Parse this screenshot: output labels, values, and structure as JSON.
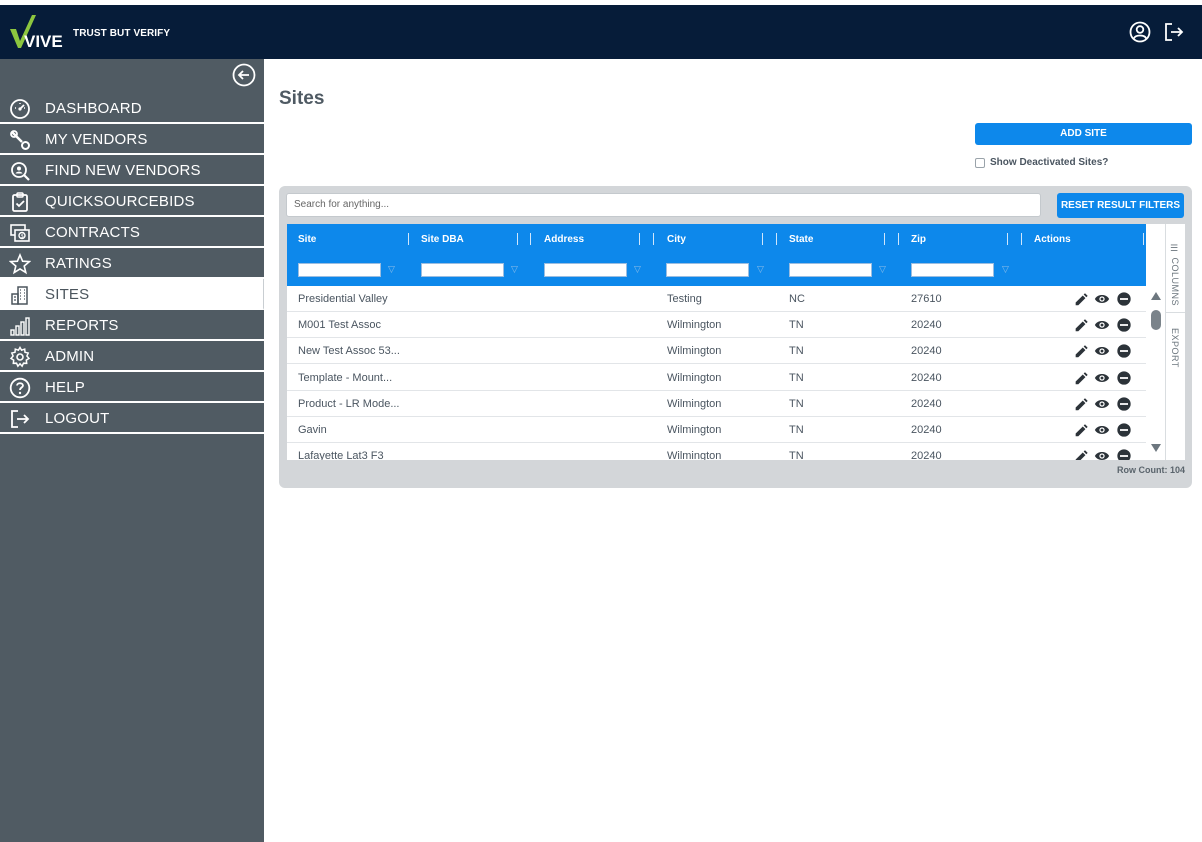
{
  "header": {
    "logo_text": "VIVE",
    "tagline": "TRUST BUT VERIFY",
    "brand_green": "#8cc63f",
    "navy": "#061c39",
    "icons": [
      "user-circle-icon",
      "logout-icon"
    ]
  },
  "sidebar": {
    "items": [
      {
        "label": "DASHBOARD",
        "icon": "speedometer-icon"
      },
      {
        "label": "MY VENDORS",
        "icon": "wrench-icon"
      },
      {
        "label": "FIND NEW VENDORS",
        "icon": "search-person-icon"
      },
      {
        "label": "QUICKSOURCEBIDS",
        "icon": "clipboard-check-icon"
      },
      {
        "label": "CONTRACTS",
        "icon": "money-icon"
      },
      {
        "label": "RATINGS",
        "icon": "star-icon"
      },
      {
        "label": "SITES",
        "icon": "building-icon",
        "active": true
      },
      {
        "label": "REPORTS",
        "icon": "bar-chart-icon"
      },
      {
        "label": "ADMIN",
        "icon": "gear-icon"
      },
      {
        "label": "HELP",
        "icon": "help-icon"
      },
      {
        "label": "LOGOUT",
        "icon": "logout-icon"
      }
    ]
  },
  "main": {
    "title": "Sites",
    "add_site_label": "ADD SITE",
    "show_deactivated_label": "Show Deactivated Sites?",
    "search_placeholder": "Search for anything...",
    "reset_filters_label": "RESET RESULT FILTERS",
    "columns_label": "COLUMNS",
    "export_label": "EXPORT",
    "row_count_label": "Row Count: 104"
  },
  "table": {
    "columns": [
      "Site",
      "Site DBA",
      "Address",
      "City",
      "State",
      "Zip",
      "Actions"
    ],
    "rows": [
      {
        "site": "Presidential Valley",
        "dba": "",
        "address": "",
        "city": "Testing",
        "state": "NC",
        "zip": "27610"
      },
      {
        "site": "M001 Test Assoc",
        "dba": "",
        "address": "",
        "city": "Wilmington",
        "state": "TN",
        "zip": "20240"
      },
      {
        "site": "New Test Assoc 53...",
        "dba": "",
        "address": "",
        "city": "Wilmington",
        "state": "TN",
        "zip": "20240"
      },
      {
        "site": "Template - Mount...",
        "dba": "",
        "address": "",
        "city": "Wilmington",
        "state": "TN",
        "zip": "20240"
      },
      {
        "site": "Product - LR Mode...",
        "dba": "",
        "address": "",
        "city": "Wilmington",
        "state": "TN",
        "zip": "20240"
      },
      {
        "site": "Gavin",
        "dba": "",
        "address": "",
        "city": "Wilmington",
        "state": "TN",
        "zip": "20240"
      },
      {
        "site": "Lafayette Lat3 F3",
        "dba": "",
        "address": "",
        "city": "Wilmington",
        "state": "TN",
        "zip": "20240"
      }
    ],
    "header_blue": "#0d88eb"
  }
}
